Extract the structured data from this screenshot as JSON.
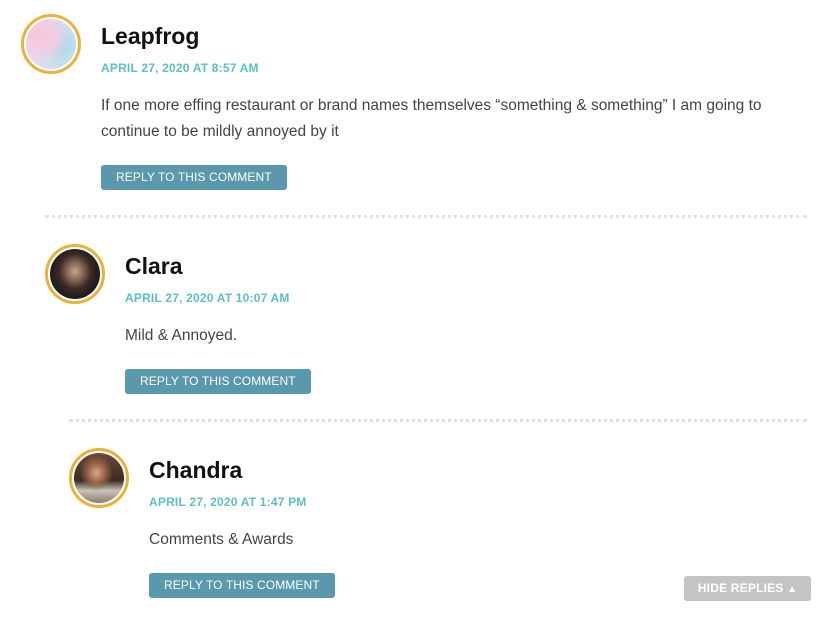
{
  "comments": [
    {
      "author": "Leapfrog",
      "date": "APRIL 27, 2020 AT 8:57 AM",
      "text": "If one more effing restaurant or brand names themselves “something & something” I am going to continue to be mildly annoyed by it",
      "reply_label": "REPLY TO THIS COMMENT"
    },
    {
      "author": "Clara",
      "date": "APRIL 27, 2020 AT 10:07 AM",
      "text": "Mild & Annoyed.",
      "reply_label": "REPLY TO THIS COMMENT"
    },
    {
      "author": "Chandra",
      "date": "APRIL 27, 2020 AT 1:47 PM",
      "text": "Comments & Awards",
      "reply_label": "REPLY TO THIS COMMENT"
    }
  ],
  "hide_replies": {
    "label": "HIDE REPLIES",
    "icon": "triangle-up-icon",
    "arrow": "▲"
  },
  "colors": {
    "avatar_border": "#e8b33b",
    "date": "#5bbfc6",
    "reply_button": "#5a98ad",
    "hide_replies": "#c4c4c4"
  }
}
